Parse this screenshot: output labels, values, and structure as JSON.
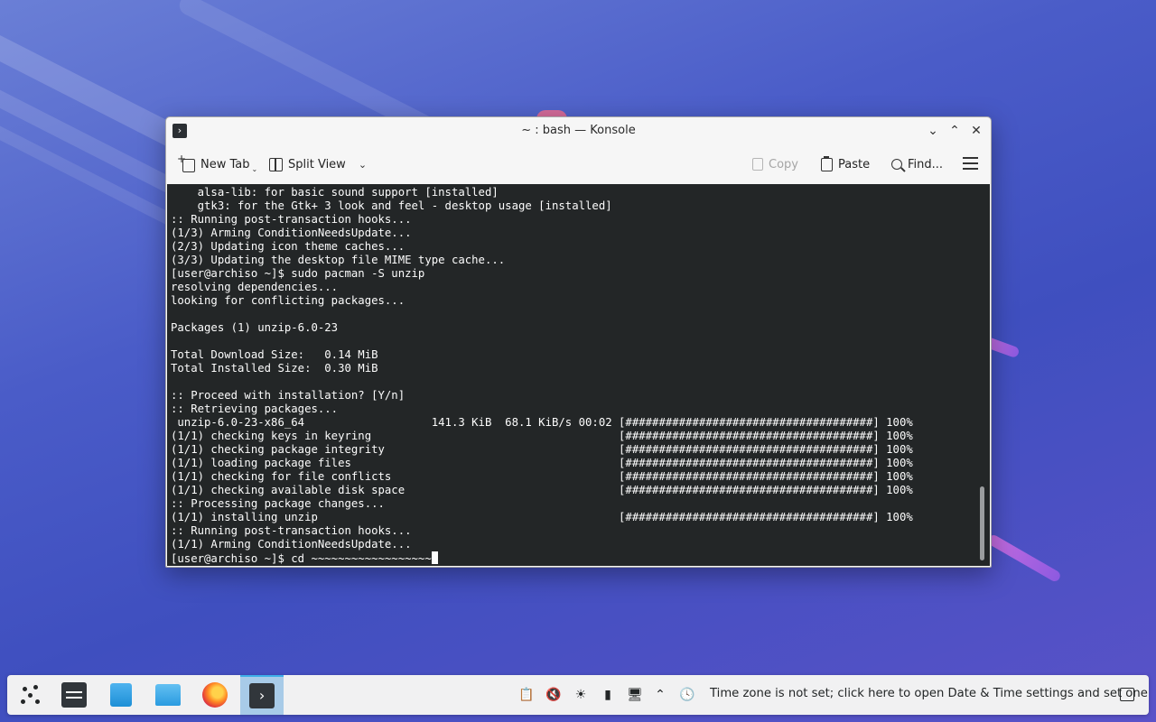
{
  "window": {
    "title": "~ : bash — Konsole",
    "controls": {
      "minimize": "⌄",
      "maximize": "⌃",
      "close": "✕"
    }
  },
  "toolbar": {
    "new_tab": "New Tab",
    "split_view": "Split View",
    "copy": "Copy",
    "paste": "Paste",
    "find": "Find..."
  },
  "terminal": {
    "lines": [
      "    alsa-lib: for basic sound support [installed]",
      "    gtk3: for the Gtk+ 3 look and feel - desktop usage [installed]",
      ":: Running post-transaction hooks...",
      "(1/3) Arming ConditionNeedsUpdate...",
      "(2/3) Updating icon theme caches...",
      "(3/3) Updating the desktop file MIME type cache...",
      "[user@archiso ~]$ sudo pacman -S unzip",
      "resolving dependencies...",
      "looking for conflicting packages...",
      "",
      "Packages (1) unzip-6.0-23",
      "",
      "Total Download Size:   0.14 MiB",
      "Total Installed Size:  0.30 MiB",
      "",
      ":: Proceed with installation? [Y/n]",
      ":: Retrieving packages...",
      " unzip-6.0-23-x86_64                   141.3 KiB  68.1 KiB/s 00:02 [#####################################] 100%",
      "(1/1) checking keys in keyring                                     [#####################################] 100%",
      "(1/1) checking package integrity                                   [#####################################] 100%",
      "(1/1) loading package files                                        [#####################################] 100%",
      "(1/1) checking for file conflicts                                  [#####################################] 100%",
      "(1/1) checking available disk space                                [#####################################] 100%",
      ":: Processing package changes...",
      "(1/1) installing unzip                                             [#####################################] 100%",
      ":: Running post-transaction hooks...",
      "(1/1) Arming ConditionNeedsUpdate..."
    ],
    "prompt": "[user@archiso ~]$ cd ~~~~~~~~~~~~~~~~~~"
  },
  "taskbar": {
    "apps": [
      {
        "name": "application-launcher",
        "icon": "launcher-icon"
      },
      {
        "name": "system-settings",
        "icon": "system-settings-icon"
      },
      {
        "name": "discover",
        "icon": "discover-icon"
      },
      {
        "name": "dolphin",
        "icon": "folder-icon"
      },
      {
        "name": "firefox",
        "icon": "firefox-icon"
      },
      {
        "name": "konsole",
        "icon": "konsole-icon",
        "active": true
      }
    ],
    "tray_icons": [
      "clipboard-icon",
      "volume-muted-icon",
      "brightness-icon",
      "usb-device-icon",
      "display-icon",
      "chevron-up-icon",
      "clock-alert-icon"
    ],
    "timezone_message": "Time zone is not set; click here to open Date & Time settings and set one"
  },
  "colors": {
    "terminal_bg": "#232627",
    "terminal_fg": "#fcfcfc",
    "active_task": "#a8cbe8",
    "accent": "#3daee9"
  }
}
